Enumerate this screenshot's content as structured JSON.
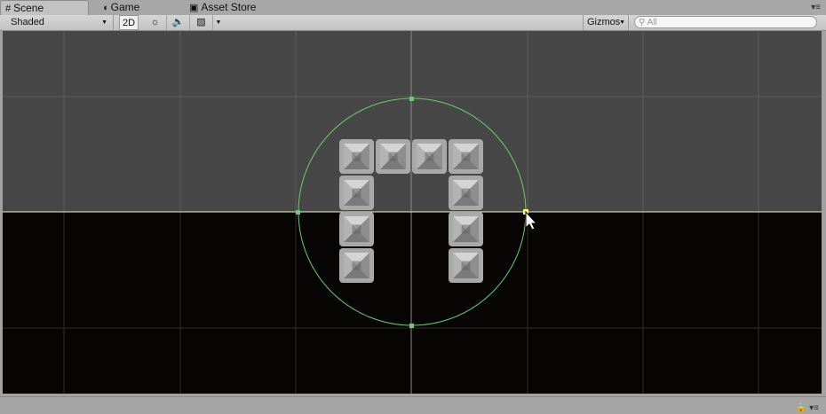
{
  "tabs": [
    {
      "label": "Scene",
      "icon": "grid-icon"
    },
    {
      "label": "Game",
      "icon": "pacman-icon"
    },
    {
      "label": "Asset Store",
      "icon": "store-icon"
    }
  ],
  "toolbar": {
    "shading_mode": "Shaded",
    "mode_2d": "2D",
    "gizmos_label": "Gizmos",
    "search_placeholder": "All"
  },
  "scene": {
    "colors": {
      "sky": "#474747",
      "ground": "#070503",
      "grid_sky": "#5c5c5c",
      "grid_ground": "#2d2d2d",
      "axis": "#8a8a8a",
      "horizon": "#e8f2c8",
      "collider": "#63d163",
      "tile_edge": "#d9d9d9",
      "tile_center": "#5e5e5e"
    },
    "tiles": [
      [
        0,
        0
      ],
      [
        1,
        0
      ],
      [
        2,
        0
      ],
      [
        3,
        0
      ],
      [
        0,
        1
      ],
      [
        3,
        1
      ],
      [
        0,
        2
      ],
      [
        3,
        2
      ],
      [
        0,
        3
      ],
      [
        3,
        3
      ]
    ]
  }
}
